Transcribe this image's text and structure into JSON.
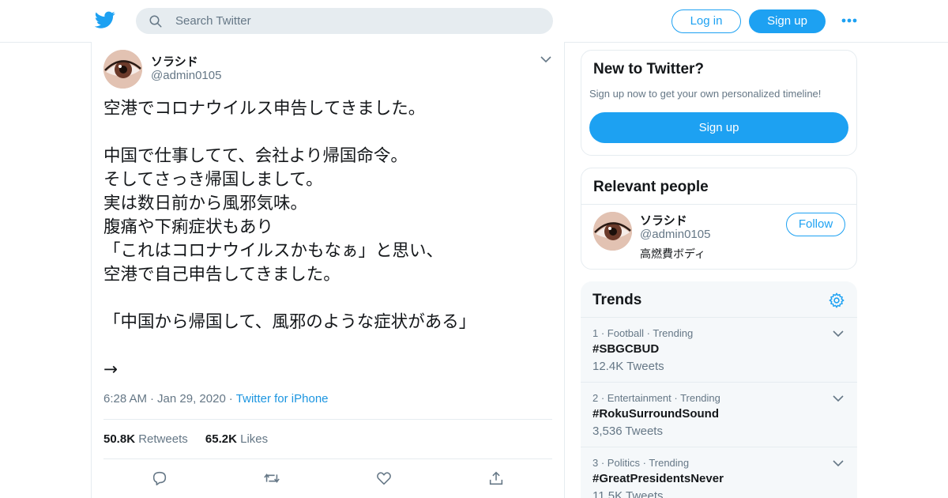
{
  "header": {
    "search_placeholder": "Search Twitter",
    "login_label": "Log in",
    "signup_label": "Sign up",
    "icons": {
      "logo": "twitter-bird-icon",
      "search": "search-icon",
      "more": "more-dots-icon"
    },
    "accent_color": "#1da1f2"
  },
  "tweet": {
    "display_name": "ソラシド",
    "screen_name": "@admin0105",
    "text": "空港でコロナウイルス申告してきました。\n\n中国で仕事してて、会社より帰国命令。\nそしてさっき帰国しまして。\n実は数日前から風邪気味。\n腹痛や下痢症状もあり\n「これはコロナウイルスかもなぁ」と思い、\n空港で自己申告してきました。\n\n「中国から帰国して、風邪のような症状がある」\n\n→",
    "time": "6:28 AM",
    "date": "Jan 29, 2020",
    "source": "Twitter for iPhone",
    "retweets_count": "50.8K",
    "retweets_label": "Retweets",
    "likes_count": "65.2K",
    "likes_label": "Likes",
    "action_icons": [
      "reply-icon",
      "retweet-icon",
      "like-icon",
      "share-icon"
    ]
  },
  "sidebar": {
    "new_to_twitter": {
      "title": "New to Twitter?",
      "subtitle": "Sign up now to get your own personalized timeline!",
      "button_label": "Sign up"
    },
    "relevant_people": {
      "title": "Relevant people",
      "person": {
        "display_name": "ソラシド",
        "screen_name": "@admin0105",
        "bio": "高燃費ボディ",
        "follow_label": "Follow"
      }
    },
    "trends": {
      "title": "Trends",
      "items": [
        {
          "rank": "1",
          "category": "Football",
          "status": "Trending",
          "name": "#SBGCBUD",
          "count": "12.4K Tweets"
        },
        {
          "rank": "2",
          "category": "Entertainment",
          "status": "Trending",
          "name": "#RokuSurroundSound",
          "count": "3,536 Tweets"
        },
        {
          "rank": "3",
          "category": "Politics",
          "status": "Trending",
          "name": "#GreatPresidentsNever",
          "count": "11.5K Tweets"
        }
      ]
    }
  }
}
